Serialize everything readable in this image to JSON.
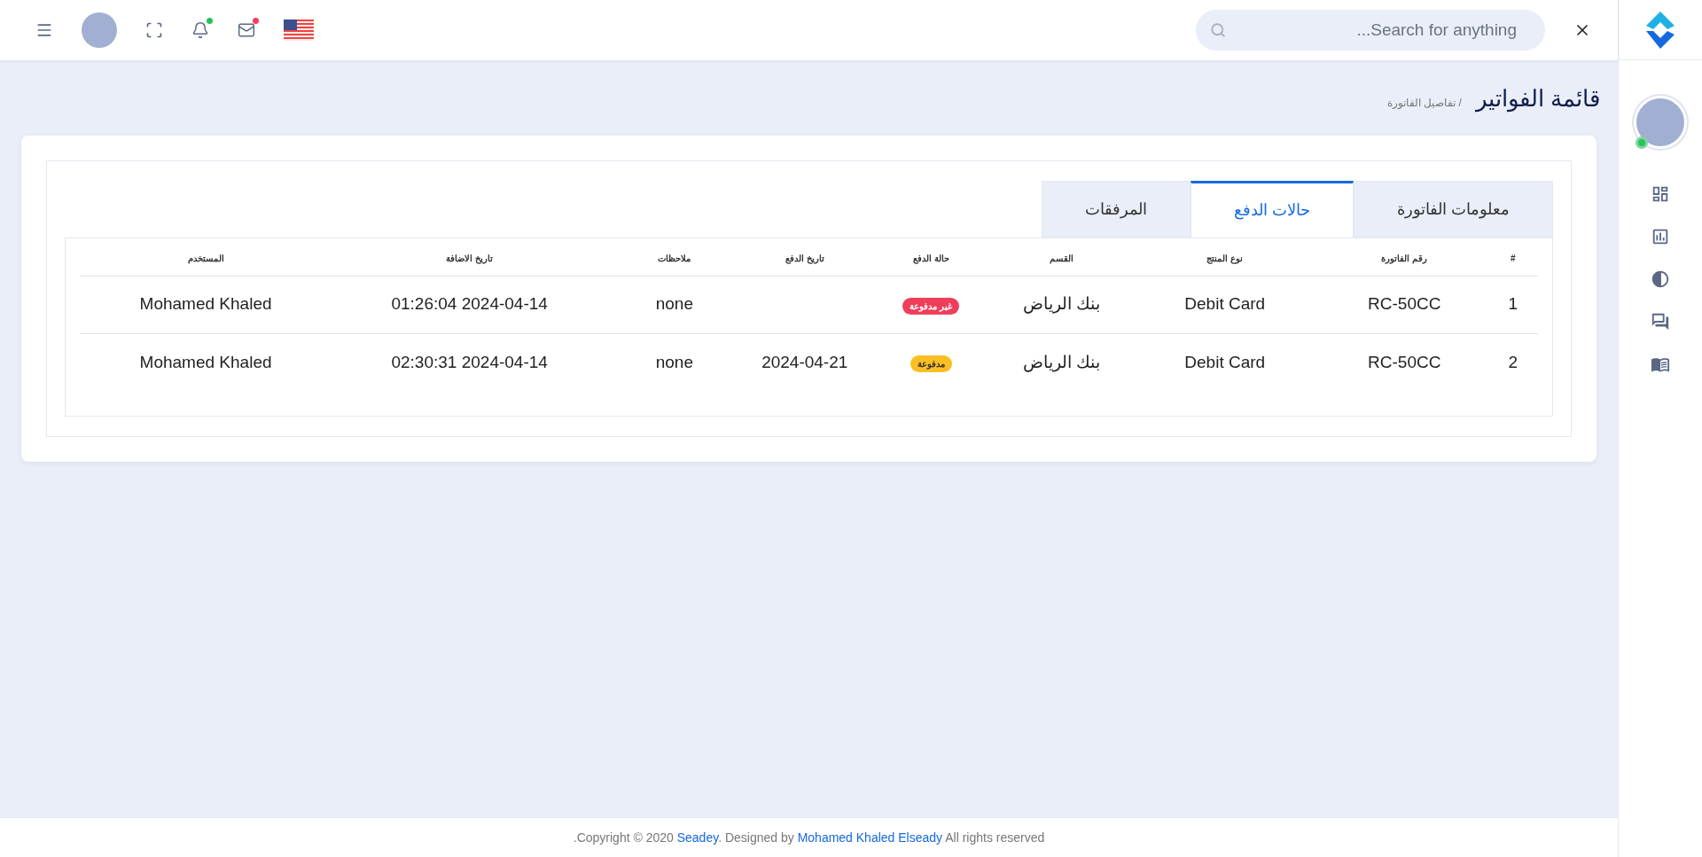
{
  "top_bar": {
    "alerts": [
      {
        "kind": "bell",
        "color": "#22c55e"
      },
      {
        "kind": "mail",
        "color": "#f43f5e"
      }
    ],
    "search": {
      "placeholder": "...Search for anything"
    }
  },
  "page": {
    "title": "قائمة الفواتير",
    "breadcrumb": "/ تفاصيل الفاتورة"
  },
  "tabs": [
    {
      "label": "معلومات الفاتورة",
      "selected": false
    },
    {
      "label": "حالات الدفع",
      "selected": true
    },
    {
      "label": "المرفقات",
      "selected": false
    }
  ],
  "table": {
    "columns": [
      "#",
      "رقم الفاتورة",
      "نوع المنتج",
      "القسم",
      "حالة الدفع",
      "تاريخ الدفع",
      "ملاحظات",
      "تاريخ الاضافة",
      "المستخدم"
    ],
    "rows": [
      {
        "index": "1",
        "invoice": "RC-50CC",
        "product": "Debit Card",
        "department": "بنك الرياض",
        "status": {
          "label": "غير مدفوعة",
          "paid": false
        },
        "notes": "none",
        "added": "01:26:04 2024-04-14",
        "user": "Mohamed Khaled"
      },
      {
        "index": "2",
        "invoice": "RC-50CC",
        "product": "Debit Card",
        "department": "بنك الرياض",
        "status": {
          "label": "مدفوعة",
          "paid": true
        },
        "payment_date": "2024-04-21",
        "notes": "none",
        "added": "02:30:31 2024-04-14",
        "user": "Mohamed Khaled"
      }
    ]
  },
  "footer": {
    "copyright": ".Copyright © 2020",
    "company_link": "Seadey",
    "designed_by": ". Designed by",
    "designer_link": "Mohamed Khaled Elseady",
    "rights": "All rights reserved"
  }
}
